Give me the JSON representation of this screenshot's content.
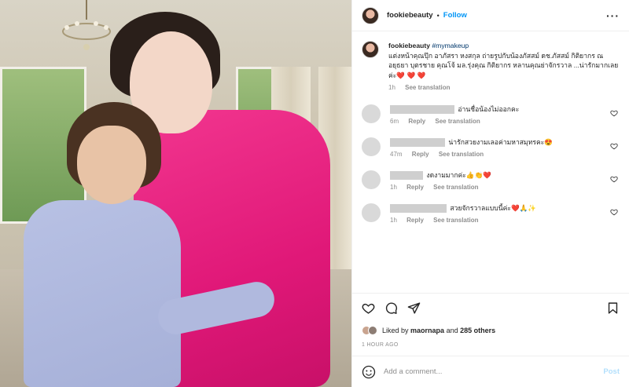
{
  "post": {
    "username": "fookiebeauty",
    "separator": "•",
    "follow_label": "Follow",
    "more_icon": "more-horizontal-icon"
  },
  "caption": {
    "username": "fookiebeauty",
    "hashtag": "#mymakeup",
    "text": "แต่งหน้าคุณปุ๊ก อาภัสรา หงสกุล ถ่ายรูปกับน้องภัสสม์ ดช.ภัสสม์ กิติยากร ณ อยุธยา บุตรชาย คุณโจ้ มล.รุ่งคุณ กิติยากร หลานคุณย่าจักรวาล ...น่ารักมากเลยค่ะ❤️ ❤️ ❤️",
    "time": "1h",
    "see_translation": "See translation"
  },
  "comments": [
    {
      "text": "อ่านชื่อน้องไม่ออกคะ",
      "time": "6m",
      "reply": "Reply",
      "see_translation": "See translation"
    },
    {
      "text": "น่ารักสวยงามเลอค่ามหาสมุทรคะ😍",
      "time": "47m",
      "reply": "Reply",
      "see_translation": "See translation"
    },
    {
      "text": "งดงามมากค่ะ👍👏❤️",
      "time": "1h",
      "reply": "Reply",
      "see_translation": "See translation"
    },
    {
      "text": "สวยจักรวาลแบบนี้ค่ะ❤️🙏✨",
      "time": "1h",
      "reply": "Reply",
      "see_translation": "See translation"
    }
  ],
  "likes": {
    "prefix": "Liked by",
    "user": "maornapa",
    "middle": "and",
    "count": "285 others"
  },
  "timestamp": "1 HOUR AGO",
  "add_comment": {
    "placeholder": "Add a comment...",
    "post_label": "Post"
  },
  "colors": {
    "accent": "#0095f6",
    "post_disabled": "#b2dffc",
    "dress_pink": "#e01878"
  }
}
